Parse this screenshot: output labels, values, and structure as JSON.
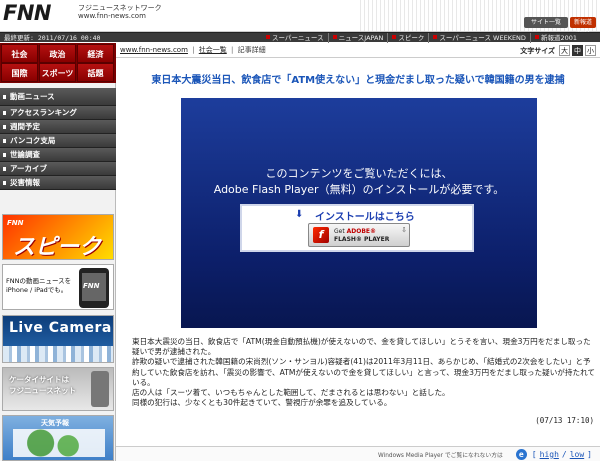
{
  "header": {
    "logo": "FNN",
    "site_name": "フジニュースネットワーク",
    "site_url": "www.fnn-news.com",
    "site_button": "サイト一覧",
    "site_button2": "新報道2001"
  },
  "topbar": {
    "updated": "最終更新: 2011/07/16 00:40",
    "links": [
      "スーパーニュース",
      "ニュースJAPAN",
      "スピーク",
      "スーパーニュース WEEKEND",
      "新報道2001"
    ]
  },
  "sidebar": {
    "categories": [
      "社会",
      "政治",
      "経済",
      "国際",
      "スポーツ",
      "話題"
    ],
    "menu": [
      "動画ニュース",
      "アクセスランキング",
      "週間予定",
      "バンコク支局",
      "世論調査",
      "アーカイブ",
      "災害情報"
    ],
    "banner_speak_small": "FNN",
    "banner_speak": "スピーク",
    "banner_iphone_line1": "FNNの動画ニュースを",
    "banner_iphone_line2": "iPhone / iPadでも。",
    "banner_iphone_logo": "FNN",
    "banner_live": "Live Camera",
    "banner_ktai_line1": "ケータイサイトは",
    "banner_ktai_line2": "フジニュースネット",
    "banner_weather": "天気予報"
  },
  "breadcrumb": {
    "home": "www.fnn-news.com",
    "category": "社会一覧",
    "current": "記事詳細",
    "separator": "|"
  },
  "fontsize": {
    "label": "文字サイズ",
    "options": [
      "大",
      "中",
      "小"
    ],
    "selected": "中"
  },
  "article": {
    "headline": "東日本大震災当日、飲食店で「ATM使えない」と現金だまし取った疑いで韓国籍の男を逮捕",
    "player_msg1": "このコンテンツをご覧いただくには、",
    "player_msg2": "Adobe Flash Player（無料）のインストールが必要です。",
    "install_label": "インストールはこちら",
    "get_flash_line1_prefix": "Get ",
    "get_flash_line1_brand": "ADOBE®",
    "get_flash_line2": "FLASH® PLAYER",
    "body": [
      "東日本大震災の当日、飲食店で「ATM(現金自動預払機)が使えないので、金を貸してほしい」とうそを言い、現金3万円をだまし取った疑いで男が逮捕された。",
      "詐欺の疑いで逮捕された韓国籍の宋尚烈(ソン・サンヨル)容疑者(41)は2011年3月11日、あらかじめ、「結婚式の2次会をしたい」と予約していた飲食店を訪れ、「震災の影響で、ATMが使えないので金を貸してほしい」と言って、現金3万円をだまし取った疑いが持たれている。",
      "店の人は「スーツ着て、いつもちゃんとした範囲して、だまされるとは思わない」と話した。",
      "同様の犯行は、少なくとも30件起きていて、警視庁が余罪を追及している。"
    ],
    "timestamp": "(07/13 17:10)"
  },
  "footer": {
    "wmp_note": "Windows Media Player でご覧になれない方は",
    "quality_high": "high",
    "quality_low": "low",
    "bracket_open": "[",
    "bracket_close": "]",
    "divider": "/"
  },
  "colors": {
    "headline": "#1a55b8",
    "category_red": "#b51010",
    "player_blue": "#1d3d9c"
  }
}
